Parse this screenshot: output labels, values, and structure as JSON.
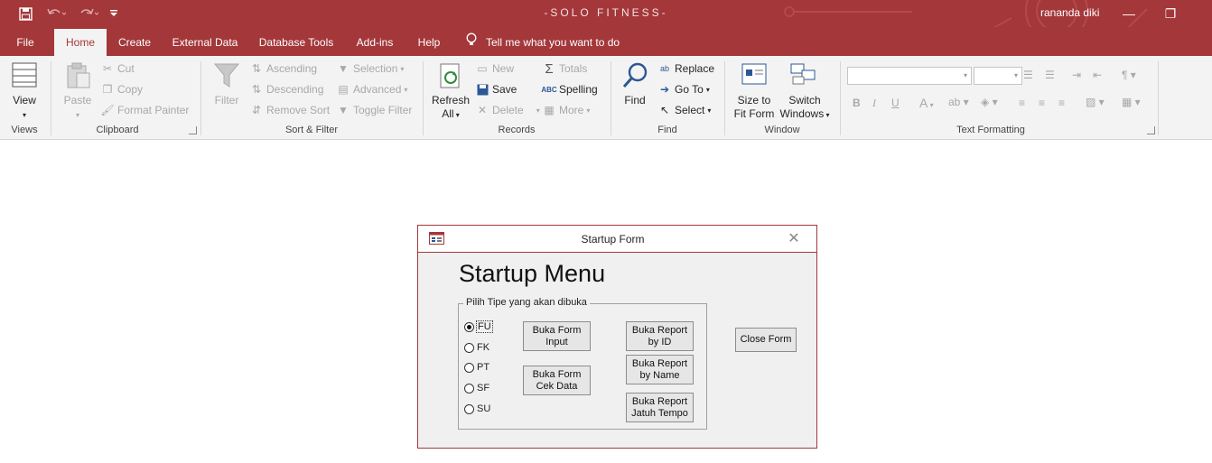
{
  "window": {
    "app_title": "-SOLO FITNESS-",
    "user_name": "rananda diki",
    "minimize": "—",
    "restore": "❐"
  },
  "qat": {
    "save_icon": "save-icon",
    "undo_icon": "undo-icon",
    "redo_icon": "redo-icon",
    "customize_icon": "customize-qat-icon"
  },
  "menu": {
    "tabs": [
      "File",
      "Home",
      "Create",
      "External Data",
      "Database Tools",
      "Add-ins",
      "Help"
    ],
    "active": "Home",
    "tell_me": "Tell me what you want to do"
  },
  "ribbon": {
    "views": {
      "label": "Views",
      "view": "View"
    },
    "clipboard": {
      "label": "Clipboard",
      "paste": "Paste",
      "cut": "Cut",
      "copy": "Copy",
      "format_painter": "Format Painter"
    },
    "sort_filter": {
      "label": "Sort & Filter",
      "filter": "Filter",
      "ascending": "Ascending",
      "descending": "Descending",
      "remove_sort": "Remove Sort",
      "selection": "Selection",
      "advanced": "Advanced",
      "toggle_filter": "Toggle Filter"
    },
    "records": {
      "label": "Records",
      "refresh": "Refresh",
      "refresh_all": "All",
      "new": "New",
      "save": "Save",
      "delete": "Delete",
      "totals": "Totals",
      "spelling": "Spelling",
      "more": "More"
    },
    "find": {
      "label": "Find",
      "find": "Find",
      "replace": "Replace",
      "goto": "Go To",
      "select": "Select"
    },
    "window": {
      "label": "Window",
      "size_to_fit": "Size to",
      "size_to_fit_2": "Fit Form",
      "switch": "Switch",
      "switch_2": "Windows"
    },
    "text_formatting": {
      "label": "Text Formatting",
      "bold": "B",
      "italic": "I",
      "underline": "U",
      "font_color": "A"
    }
  },
  "dialog": {
    "title": "Startup Form",
    "heading": "Startup Menu",
    "frame_label": "Pilih Tipe yang akan dibuka",
    "options": [
      "FU",
      "FK",
      "PT",
      "SF",
      "SU"
    ],
    "selected": "FU",
    "buttons": {
      "form_input": "Buka Form\nInput",
      "form_cek": "Buka Form\nCek Data",
      "report_id": "Buka Report\nby ID",
      "report_name": "Buka Report\nby Name",
      "report_tempo": "Buka Report\nJatuh Tempo",
      "close": "Close Form"
    }
  },
  "colors": {
    "accent": "#a4373a",
    "ribbon_bg": "#f3f3f3",
    "dialog_bg": "#f0f0f0"
  }
}
